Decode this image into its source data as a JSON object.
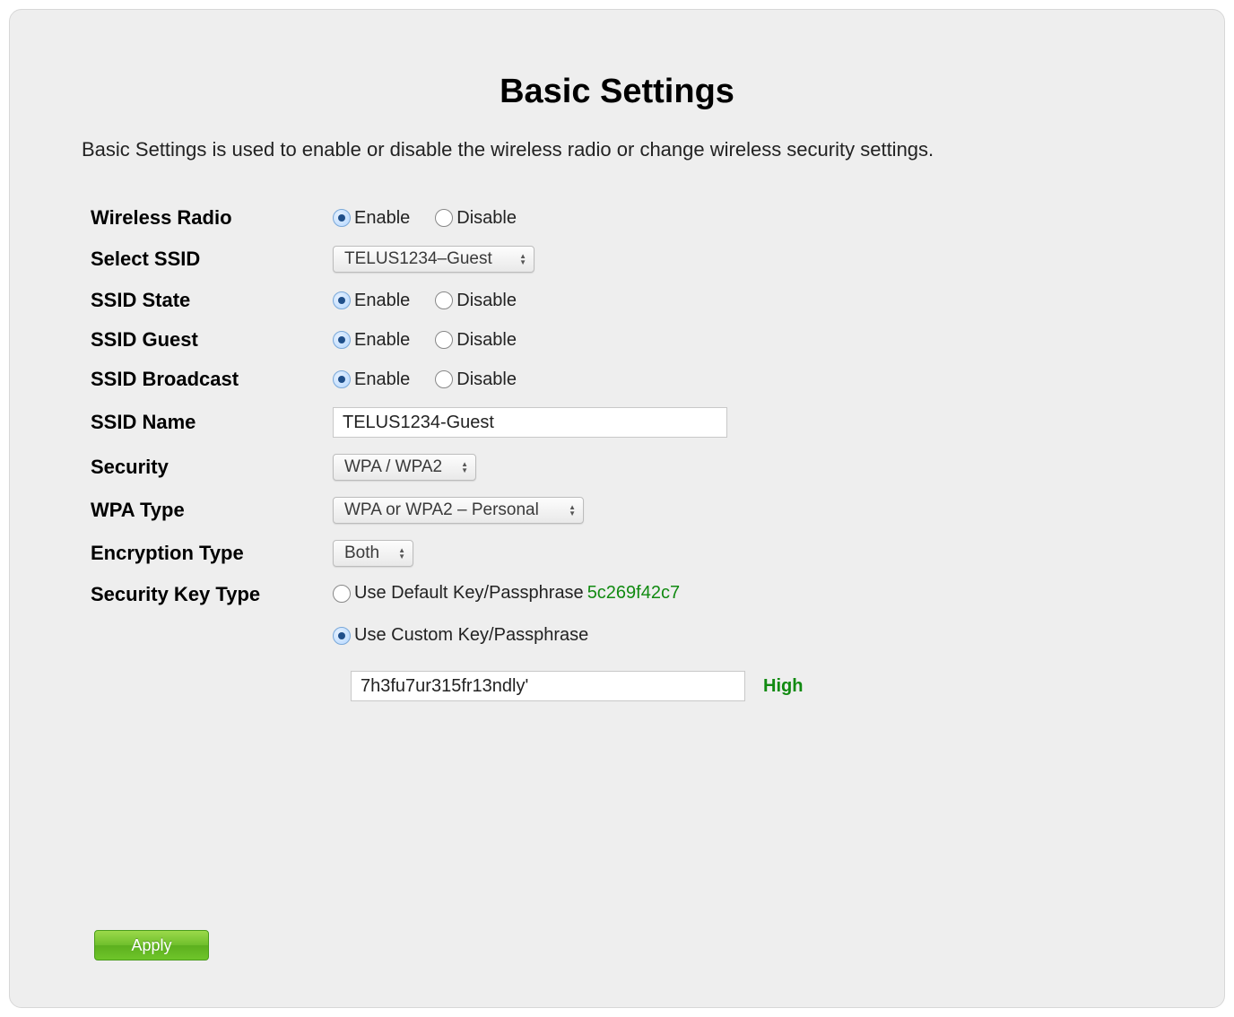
{
  "title": "Basic Settings",
  "description": "Basic Settings is used to enable or disable the wireless radio or change wireless security settings.",
  "labels": {
    "wireless_radio": "Wireless Radio",
    "select_ssid": "Select SSID",
    "ssid_state": "SSID State",
    "ssid_guest": "SSID Guest",
    "ssid_broadcast": "SSID Broadcast",
    "ssid_name": "SSID Name",
    "security": "Security",
    "wpa_type": "WPA Type",
    "encryption_type": "Encryption Type",
    "security_key_type": "Security Key Type"
  },
  "options": {
    "enable": "Enable",
    "disable": "Disable",
    "use_default": "Use Default Key/Passphrase",
    "use_custom": "Use Custom Key/Passphrase"
  },
  "values": {
    "wireless_radio": "enable",
    "select_ssid": "TELUS1234–Guest",
    "ssid_state": "enable",
    "ssid_guest": "enable",
    "ssid_broadcast": "enable",
    "ssid_name": "TELUS1234-Guest",
    "security": "WPA / WPA2",
    "wpa_type": "WPA or WPA2 – Personal",
    "encryption_type": "Both",
    "security_key_type": "custom",
    "default_passphrase": "5c269f42c7",
    "custom_passphrase": "7h3fu7ur315fr13ndly'",
    "strength": "High"
  },
  "buttons": {
    "apply": "Apply"
  }
}
